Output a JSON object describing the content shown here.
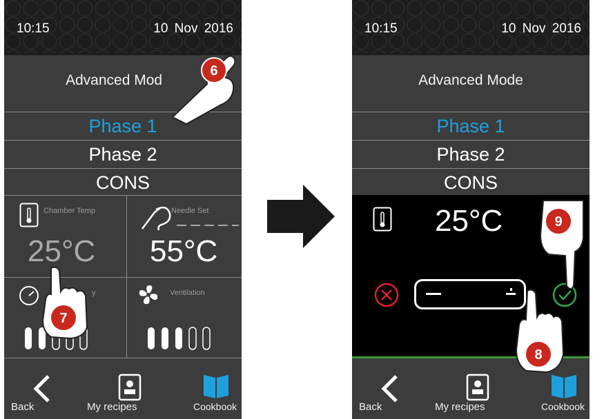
{
  "status": {
    "time": "10:15",
    "date": "10  Nov  2016"
  },
  "mode_title": "Advanced Mode",
  "left_mode_title": "Advanced Mod",
  "phases": [
    "Phase 1",
    "Phase 2",
    "CONS"
  ],
  "tiles": {
    "chamber_label": "Chamber Temp",
    "chamber_value": "25°C",
    "needle_label": "Needle Set",
    "needle_value": "55°C",
    "humidity_label": "y",
    "ventilation_label": "Ventilation"
  },
  "setpoint": {
    "value": "25°C"
  },
  "nav": {
    "back": "Back",
    "recipes": "My recipes",
    "cookbook": "Cookbook"
  },
  "callouts": [
    "6",
    "7",
    "8",
    "9"
  ],
  "colors": {
    "accent": "#1ea0dc",
    "cancel": "#e0202a",
    "confirm": "#2fa84a",
    "badge": "#c8281e"
  }
}
